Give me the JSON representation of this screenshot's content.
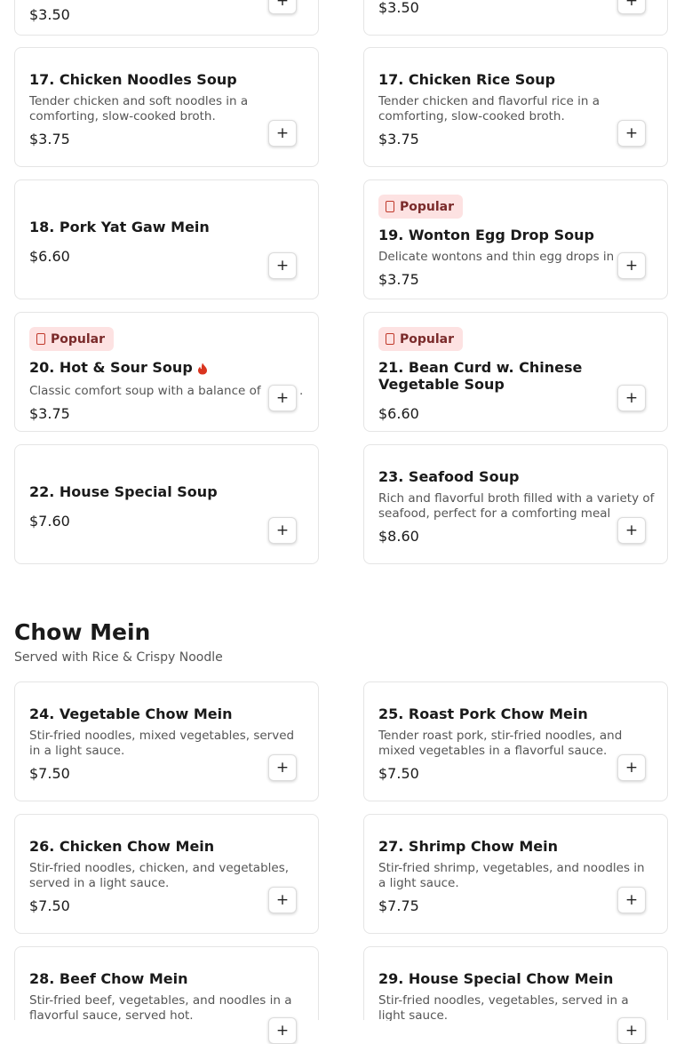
{
  "soups": {
    "top_row": [
      {
        "price": "$3.50",
        "add_label": "+"
      },
      {
        "price": "$3.50",
        "add_label": "+"
      }
    ],
    "items": [
      {
        "title": "17. Chicken Noodles Soup",
        "description": "Tender chicken and soft noodles in a comforting, slow-cooked broth.",
        "price": "$3.75",
        "add_label": "+"
      },
      {
        "title": "17. Chicken Rice Soup",
        "description": "Tender chicken and flavorful rice in a comforting, slow-cooked broth.",
        "price": "$3.75",
        "add_label": "+"
      },
      {
        "title": "18. Pork Yat Gaw Mein",
        "price": "$6.60",
        "add_label": "+"
      },
      {
        "badge": "Popular",
        "title": "19. Wonton Egg Drop Soup",
        "description": "Delicate wontons and thin egg drops in",
        "price": "$3.75",
        "add_label": "+"
      },
      {
        "badge": "Popular",
        "title": "20. Hot & Sour Soup",
        "spicy_icon": "flame-icon",
        "description": "Classic comfort soup with a balance of",
        "description_tail": ".",
        "price": "$3.75",
        "add_label": "+"
      },
      {
        "badge": "Popular",
        "title": "21. Bean Curd w. Chinese Vegetable Soup",
        "price": "$6.60",
        "add_label": "+"
      },
      {
        "title": "22. House Special Soup",
        "price": "$7.60",
        "add_label": "+"
      },
      {
        "title": "23. Seafood Soup",
        "description": "Rich and flavorful broth filled with a variety of seafood, perfect for a comforting meal",
        "price": "$8.60",
        "add_label": "+"
      }
    ]
  },
  "chow_mein": {
    "title": "Chow Mein",
    "subtitle": "Served with Rice & Crispy Noodle",
    "items": [
      {
        "title": "24. Vegetable Chow Mein",
        "description": "Stir-fried noodles, mixed vegetables, served in a light sauce.",
        "price": "$7.50",
        "add_label": "+"
      },
      {
        "title": "25. Roast Pork Chow Mein",
        "description": "Tender roast pork, stir-fried noodles, and mixed vegetables in a flavorful sauce.",
        "price": "$7.50",
        "add_label": "+"
      },
      {
        "title": "26. Chicken Chow Mein",
        "description": "Stir-fried noodles, chicken, and vegetables, served in a light sauce.",
        "price": "$7.50",
        "add_label": "+"
      },
      {
        "title": "27. Shrimp Chow Mein",
        "description": "Stir-fried shrimp, vegetables, and noodles in a light sauce.",
        "price": "$7.75",
        "add_label": "+"
      },
      {
        "title": "28. Beef Chow Mein",
        "description": "Stir-fried beef, vegetables, and noodles in a flavorful sauce, served hot.",
        "add_label": "+"
      },
      {
        "title": "29. House Special Chow Mein",
        "description": "Stir-fried noodles, vegetables, served in a light sauce.",
        "add_label": "+"
      }
    ]
  },
  "colors": {
    "badge_bg": "#fde2e2",
    "badge_text": "#7a2a2a",
    "flame": "#d9341f",
    "border": "#e5e5e5"
  }
}
